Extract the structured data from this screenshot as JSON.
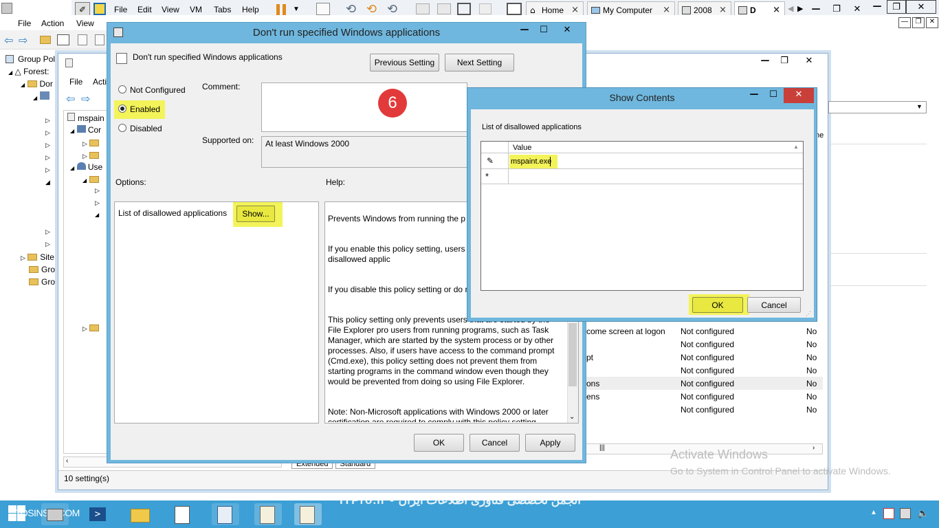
{
  "vmware": {
    "menu": [
      "File",
      "Edit",
      "View",
      "VM",
      "Tabs",
      "Help"
    ],
    "tabs": [
      {
        "label": "Home"
      },
      {
        "label": "My Computer"
      },
      {
        "label": "2008"
      },
      {
        "label": "D"
      }
    ]
  },
  "gpme": {
    "menu": [
      "File",
      "Action",
      "View"
    ],
    "tree": [
      "Group Poli",
      "Forest:",
      "Dor",
      "Site",
      "Gro",
      "Gro"
    ]
  },
  "gpo_window": {
    "menu": [
      "File",
      "Acti"
    ],
    "tree": [
      "mspain",
      "Cor",
      "Use"
    ],
    "status": "10 setting(s)",
    "tabs": [
      "Extended",
      "Standard"
    ],
    "rows": [
      {
        "name": "come screen at logon",
        "state": "Not configured",
        "comment": "No"
      },
      {
        "name": "",
        "state": "Not configured",
        "comment": "No"
      },
      {
        "name": "pt",
        "state": "Not configured",
        "comment": "No"
      },
      {
        "name": "",
        "state": "Not configured",
        "comment": "No"
      },
      {
        "name": "ons",
        "state": "Not configured",
        "comment": "No"
      },
      {
        "name": "ens",
        "state": "Not configured",
        "comment": "No"
      },
      {
        "name": "",
        "state": "Not configured",
        "comment": "No"
      }
    ],
    "right_col": "ne"
  },
  "policy_dialog": {
    "title": "Don't run specified Windows applications",
    "header": "Don't run specified Windows applications",
    "prev_button": "Previous Setting",
    "next_button": "Next Setting",
    "radio_not_configured": "Not Configured",
    "radio_enabled": "Enabled",
    "radio_disabled": "Disabled",
    "comment_label": "Comment:",
    "supported_label": "Supported on:",
    "supported_value": "At least Windows 2000",
    "options_label": "Options:",
    "help_label": "Help:",
    "option_item": "List of disallowed applications",
    "show_button": "Show...",
    "step_badge": "6",
    "help_paragraphs": [
      "Prevents Windows from running the p policy setting.",
      "If you enable this policy setting, users c you add to the list of disallowed applic",
      "If you disable this policy setting or do n run any programs.",
      "This policy setting only prevents users that are started by the File Explorer pro users from running programs, such as Task Manager, which are started by the system process or by other processes.  Also, if users have access to the command prompt (Cmd.exe), this policy setting does not prevent them from starting programs in the command window even though they would be prevented from doing so using File Explorer.",
      "Note: Non-Microsoft applications with Windows 2000 or later certification are required to comply with this policy setting.\nNote: To create a list of allowed applications, click Show.  In the"
    ],
    "ok": "OK",
    "cancel": "Cancel",
    "apply": "Apply"
  },
  "show_contents": {
    "title": "Show Contents",
    "list_label": "List of disallowed applications",
    "column_header": "Value",
    "value_row": "mspaint.exe",
    "ok": "OK",
    "cancel": "Cancel"
  },
  "watermark": {
    "activate_title": "Activate Windows",
    "activate_sub": "Go to System in Control Panel to activate Windows.",
    "brand_left": "TOSINSO.COM",
    "brand_center": "ITPro.ir - انجمن تخصصی فناوری اطلاعات ایران"
  },
  "colors": {
    "dialog_border": "#6fb7de",
    "highlight": "#f3f35a",
    "badge": "#e23a3a",
    "taskbar": "#3c9fd5"
  }
}
